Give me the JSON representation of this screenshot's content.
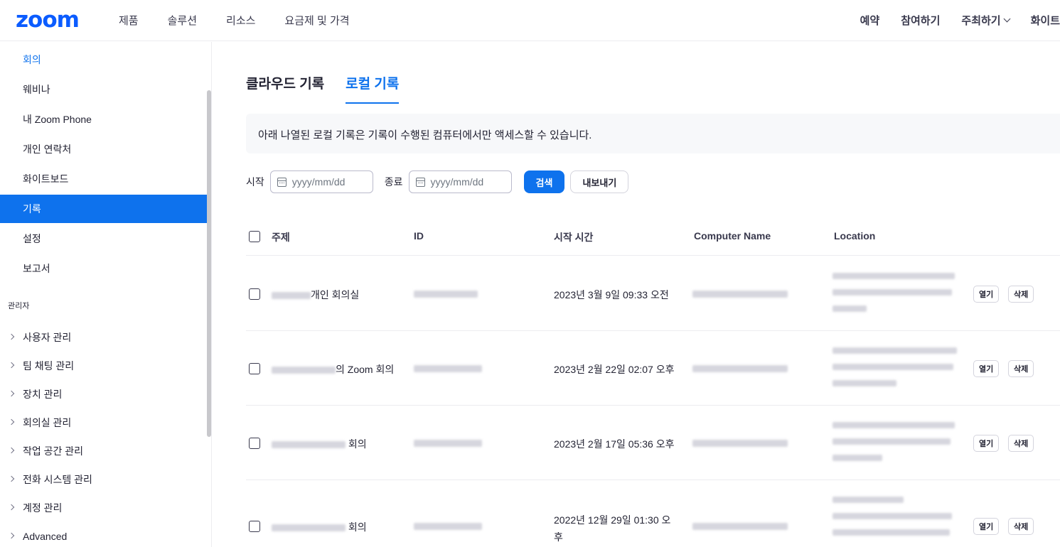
{
  "logo": "zoom",
  "nav": {
    "left": [
      "제품",
      "솔루션",
      "리소스",
      "요금제 및 가격"
    ],
    "right": [
      {
        "label": "예약",
        "dropdown": false
      },
      {
        "label": "참여하기",
        "dropdown": false
      },
      {
        "label": "주최하기",
        "dropdown": true
      },
      {
        "label": "화이트",
        "dropdown": false
      }
    ]
  },
  "sidebar": {
    "personal": [
      {
        "label": "회의",
        "state": "link"
      },
      {
        "label": "웨비나",
        "state": "normal"
      },
      {
        "label": "내 Zoom Phone",
        "state": "normal"
      },
      {
        "label": "개인 연락처",
        "state": "normal"
      },
      {
        "label": "화이트보드",
        "state": "normal"
      },
      {
        "label": "기록",
        "state": "active"
      },
      {
        "label": "설정",
        "state": "normal"
      },
      {
        "label": "보고서",
        "state": "normal"
      }
    ],
    "admin_header": "관리자",
    "admin": [
      "사용자 관리",
      "팀 채팅 관리",
      "장치 관리",
      "회의실 관리",
      "작업 공간 관리",
      "전화 시스템 관리",
      "계정 관리",
      "Advanced"
    ]
  },
  "tabs": [
    {
      "label": "클라우드 기록",
      "active": false
    },
    {
      "label": "로컬 기록",
      "active": true
    }
  ],
  "notice": "아래 나열된 로컬 기록은 기록이 수행된 컴퓨터에서만 액세스할 수 있습니다.",
  "filter": {
    "start_label": "시작",
    "end_label": "종료",
    "start_placeholder": "yyyy/mm/dd",
    "end_placeholder": "yyyy/mm/dd",
    "search_label": "검색",
    "export_label": "내보내기"
  },
  "table": {
    "headers": {
      "topic": "주제",
      "id": "ID",
      "start_time": "시작 시간",
      "computer": "Computer Name",
      "location": "Location"
    },
    "open_label": "열기",
    "delete_label": "삭제",
    "rows": [
      {
        "topic_visible": "개인 회의실",
        "start_time": "2023년 3월 9일 09:33 오전"
      },
      {
        "topic_visible": "의 Zoom 회의",
        "start_time": "2023년 2월 22일 02:07 오후"
      },
      {
        "topic_visible": "회의",
        "start_time": "2023년 2월 17일 05:36 오후"
      },
      {
        "topic_visible": "회의",
        "start_time": "2022년 12월 29일 01:30 오후"
      }
    ]
  }
}
